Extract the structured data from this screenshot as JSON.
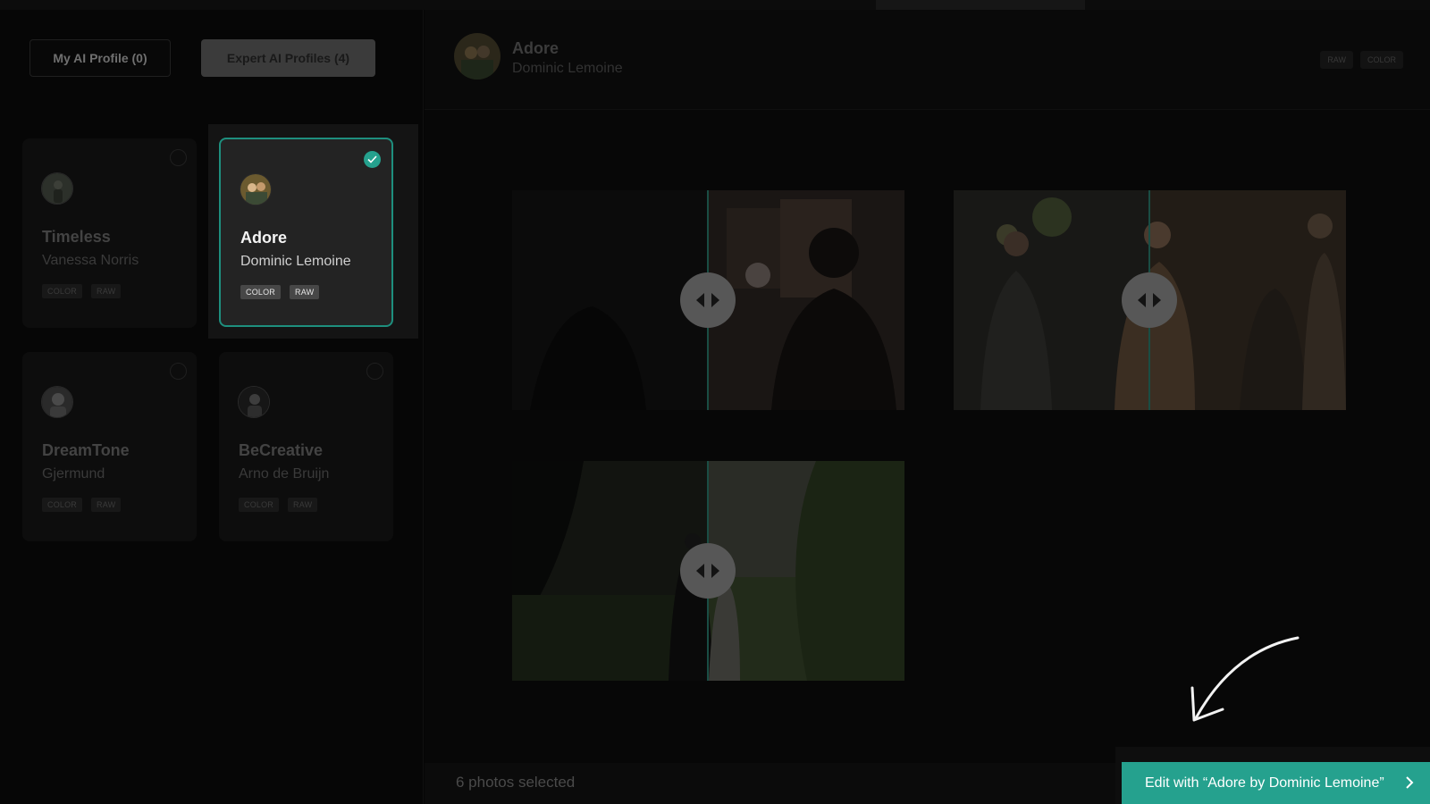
{
  "tabs": {
    "my_profile": "My AI Profile (0)",
    "expert_profiles": "Expert AI Profiles (4)"
  },
  "profiles": [
    {
      "name": "Timeless",
      "author": "Vanessa Norris",
      "tags": [
        "COLOR",
        "RAW"
      ],
      "selected": false
    },
    {
      "name": "Adore",
      "author": "Dominic Lemoine",
      "tags": [
        "COLOR",
        "RAW"
      ],
      "selected": true
    },
    {
      "name": "DreamTone",
      "author": "Gjermund",
      "tags": [
        "COLOR",
        "RAW"
      ],
      "selected": false
    },
    {
      "name": "BeCreative",
      "author": "Arno de Bruijn",
      "tags": [
        "COLOR",
        "RAW"
      ],
      "selected": false
    }
  ],
  "header": {
    "name": "Adore",
    "author": "Dominic Lemoine",
    "tags": [
      "RAW",
      "COLOR"
    ]
  },
  "footer": {
    "selected_count": "6 photos selected",
    "edit_button": "Edit with “Adore by Dominic Lemoine”"
  },
  "colors": {
    "accent": "#25a18e",
    "background": "#050505"
  },
  "icons": {
    "compare_handle": "left-right-arrows-icon",
    "check": "check-icon",
    "chevron": "chevron-right-icon"
  }
}
